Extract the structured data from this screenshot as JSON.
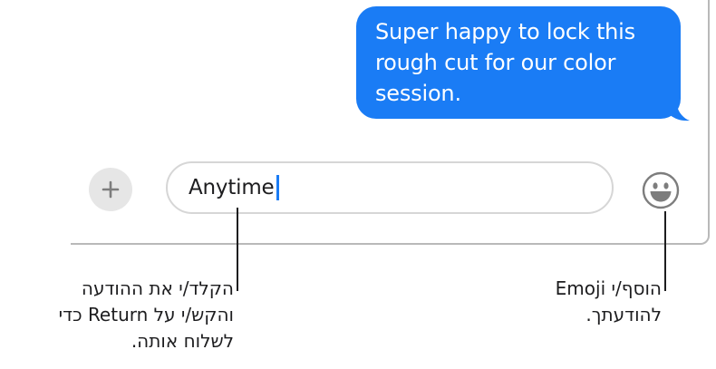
{
  "conversation": {
    "sent_message_lines": [
      "Super happy to lock this",
      "rough cut for our color",
      "session."
    ],
    "bubble_color": "#1a7cf5"
  },
  "composer": {
    "plus_icon": "plus-icon",
    "input_value": "Anytime",
    "emoji_icon": "smiley-face-icon"
  },
  "callouts": {
    "type_message_lines": [
      "הקלד/י את ההודעה",
      "והקש/י על Return כדי",
      "לשלוח אותה."
    ],
    "add_emoji_lines": [
      "הוסף/י Emoji",
      "להודעתך."
    ]
  }
}
